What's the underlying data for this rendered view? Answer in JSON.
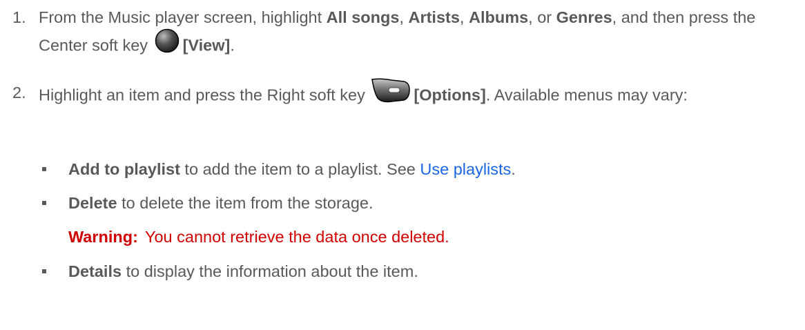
{
  "step1": {
    "number": "1.",
    "t1": "From the Music player screen, highlight ",
    "b1": "All songs",
    "t2": ", ",
    "b2": "Artists",
    "t3": ", ",
    "b3": "Albums",
    "t4": ", or ",
    "b4": "Genres",
    "t5": ", and then press the Center soft key ",
    "key_icon": "center-soft-key-icon",
    "key_label": "[View]",
    "t6": "."
  },
  "step2": {
    "number": "2.",
    "t1": "Highlight an item and press the Right soft key ",
    "key_icon": "right-soft-key-icon",
    "key_label": "[Options]",
    "t2": ". Available menus may vary:"
  },
  "bullets": [
    {
      "bold": "Add to playlist",
      "text": " to add the item to a playlist. See ",
      "link": "Use playlists",
      "tail": "."
    },
    {
      "bold": "Delete",
      "text": " to delete the item from the storage."
    },
    {
      "bold": "Details",
      "text": " to display the information about the item."
    }
  ],
  "warning": {
    "label": "Warning:",
    "text": "You cannot retrieve the data once deleted."
  }
}
